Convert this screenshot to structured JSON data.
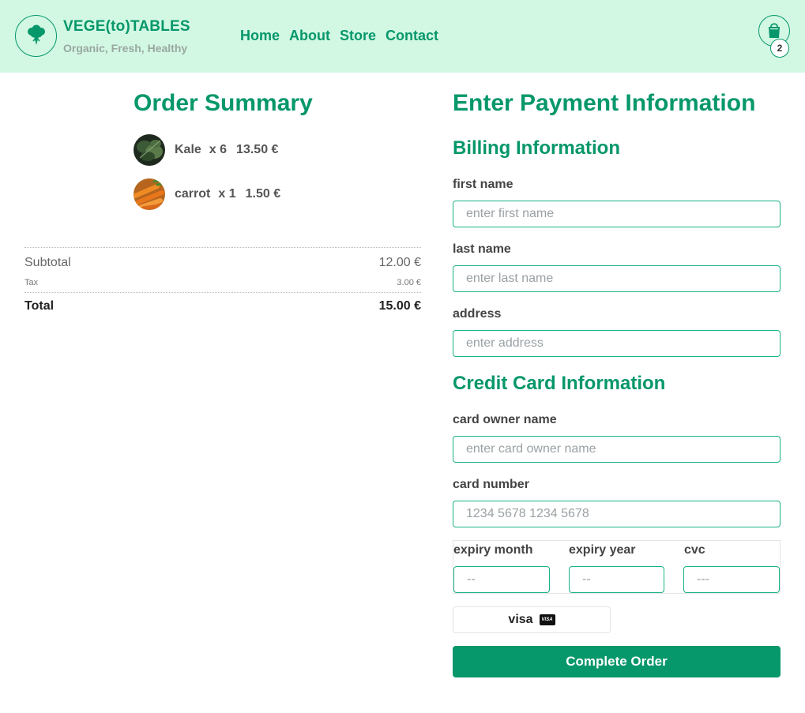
{
  "brand": {
    "name": "VEGE(to)TABLES",
    "tagline": "Organic, Fresh, Healthy",
    "accent_color": "#06976a",
    "header_bg": "#d2f8e4",
    "logo_icon": "broccoli-icon"
  },
  "nav": {
    "items": [
      {
        "label": "Home"
      },
      {
        "label": "About"
      },
      {
        "label": "Store"
      },
      {
        "label": "Contact"
      }
    ]
  },
  "cart": {
    "icon": "shopping-bag-icon",
    "count": "2"
  },
  "order_summary": {
    "title": "Order Summary",
    "items": [
      {
        "name": "Kale",
        "qty": "x 6",
        "price": "13.50 €",
        "thumb_icon": "kale-thumbnail"
      },
      {
        "name": "carrot",
        "qty": "x 1",
        "price": "1.50 €",
        "thumb_icon": "carrot-thumbnail"
      }
    ],
    "subtotal_label": "Subtotal",
    "subtotal_value": "12.00 €",
    "tax_label": "Tax",
    "tax_value": "3.00 €",
    "total_label": "Total",
    "total_value": "15.00 €"
  },
  "payment": {
    "title": "Enter Payment Information",
    "billing_title": "Billing Information",
    "first_name": {
      "label": "first name",
      "placeholder": "enter first name",
      "value": ""
    },
    "last_name": {
      "label": "last name",
      "placeholder": "enter last name",
      "value": ""
    },
    "address": {
      "label": "address",
      "placeholder": "enter address",
      "value": ""
    },
    "card_title": "Credit Card Information",
    "card_owner": {
      "label": "card owner name",
      "placeholder": "enter card owner name",
      "value": ""
    },
    "card_number": {
      "label": "card number",
      "placeholder": "1234 5678 1234 5678",
      "value": ""
    },
    "expiry_month": {
      "label": "expiry month",
      "placeholder": "--",
      "value": ""
    },
    "expiry_year": {
      "label": "expiry year",
      "placeholder": "--",
      "value": ""
    },
    "cvc": {
      "label": "cvc",
      "placeholder": "---",
      "value": ""
    },
    "card_brand": {
      "label": "visa",
      "icon": "visa-card-icon"
    },
    "submit_label": "Complete Order"
  }
}
